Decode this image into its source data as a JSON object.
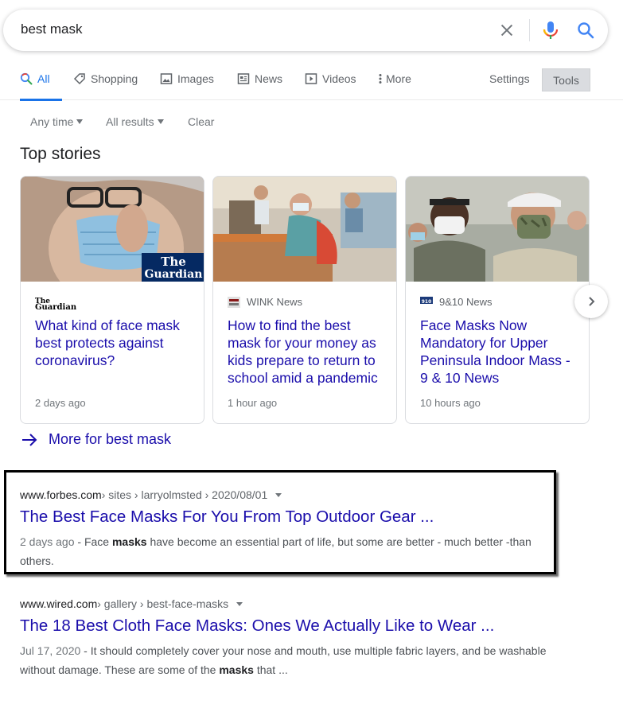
{
  "search": {
    "query": "best mask"
  },
  "tabs": [
    {
      "label": "All",
      "icon": "search-icon"
    },
    {
      "label": "Shopping",
      "icon": "tag-icon"
    },
    {
      "label": "Images",
      "icon": "image-icon"
    },
    {
      "label": "News",
      "icon": "news-icon"
    },
    {
      "label": "Videos",
      "icon": "video-icon"
    },
    {
      "label": "More",
      "icon": "more-vert-icon"
    }
  ],
  "settings_label": "Settings",
  "tools_label": "Tools",
  "filters": {
    "time": "Any time",
    "results": "All results",
    "clear": "Clear"
  },
  "top_stories": {
    "title": "Top stories",
    "cards": [
      {
        "source": "",
        "headline": "What kind of face mask best protects against coronavirus?",
        "time": "2 days ago",
        "image_logo": "The Guardian"
      },
      {
        "source": "WINK News",
        "headline": "How to find the best mask for your money as kids prepare to return to school amid a pandemic",
        "time": "1 hour ago"
      },
      {
        "source": "9&10 News",
        "headline": "Face Masks Now Mandatory for Upper Peninsula Indoor Mass - 9 & 10 News",
        "time": "10 hours ago"
      }
    ],
    "more_label": "More for best mask"
  },
  "results": [
    {
      "domain": "www.forbes.com",
      "path": " › sites › larryolmsted › 2020/08/01",
      "title": "The Best Face Masks For You From Top Outdoor Gear ...",
      "date": "2 days ago",
      "snippet_a": " - Face ",
      "snippet_bold": "masks",
      "snippet_b": " have become an essential part of life, but some are better - much better -than others."
    },
    {
      "domain": "www.wired.com",
      "path": " › gallery › best-face-masks",
      "title": "The 18 Best Cloth Face Masks: Ones We Actually Like to Wear ...",
      "date": "Jul 17, 2020",
      "snippet_a": " - It should completely cover your nose and mouth, use multiple fabric layers, and be washable without damage. These are some of the ",
      "snippet_bold": "masks",
      "snippet_b": " that ..."
    }
  ],
  "colors": {
    "link": "#1a0dab",
    "accent": "#1a73e8",
    "highlight_border": "#000000"
  }
}
